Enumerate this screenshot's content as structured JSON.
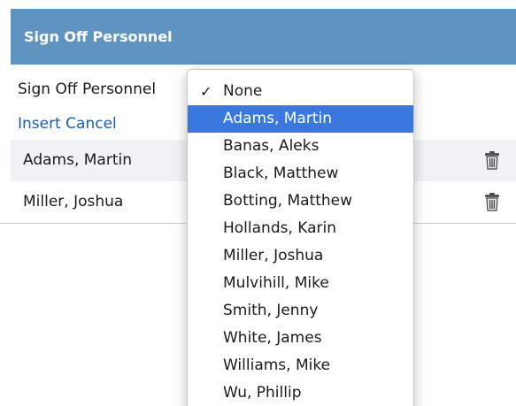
{
  "header": {
    "title": "Sign Off Personnel"
  },
  "form": {
    "field_label": "Sign Off Personnel",
    "insert_label": "Insert",
    "cancel_label": "Cancel"
  },
  "rows": [
    {
      "name": "Adams, Martin"
    },
    {
      "name": "Miller, Joshua"
    }
  ],
  "dropdown": {
    "checkmark": "✓",
    "options": [
      "None",
      "Adams, Martin",
      "Banas, Aleks",
      "Black, Matthew",
      "Botting, Matthew",
      "Hollands, Karin",
      "Miller, Joshua",
      "Mulvihill, Mike",
      "Smith, Jenny",
      "White, James",
      "Williams, Mike",
      "Wu, Phillip"
    ],
    "checked_option": "None",
    "highlighted_option": "Adams, Martin"
  },
  "colors": {
    "header_bg": "#5e94bf",
    "highlight": "#3b78de",
    "link": "#1a5da8"
  }
}
